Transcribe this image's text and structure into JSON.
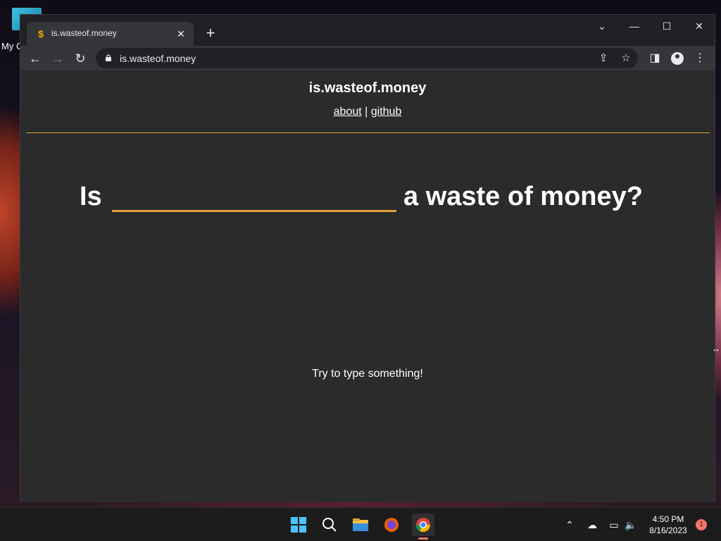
{
  "desktop": {
    "icon_label": "My C"
  },
  "browser": {
    "tab": {
      "title": "is.wasteof.money",
      "favicon": "$"
    },
    "address_bar": {
      "url": "is.wasteof.money"
    }
  },
  "page": {
    "site_title": "is.wasteof.money",
    "nav": {
      "about": "about",
      "separator": "|",
      "github": "github"
    },
    "headline": {
      "prefix": "Is",
      "input_value": "",
      "suffix": "a waste of money?"
    },
    "hint": "Try to type something!",
    "accent_color": "#e5a03a",
    "background_color": "#2b2b2b"
  },
  "taskbar": {
    "clock_time": "4:50 PM",
    "clock_date": "8/16/2023",
    "notification_count": "1"
  }
}
